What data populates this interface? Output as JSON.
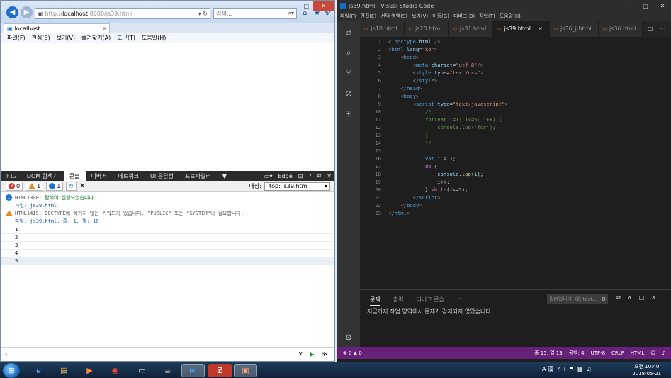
{
  "ie": {
    "url_prefix": "http://",
    "url_host": "localhost",
    "url_rest": ":8080/js39.html",
    "search_placeholder": "검색...",
    "tab_title": "localhost",
    "menu": [
      "파일(F)",
      "편집(E)",
      "보기(V)",
      "즐겨찾기(A)",
      "도구(T)",
      "도움말(H)"
    ],
    "devtools": {
      "f12_label": "F12",
      "tabs": [
        "DOM 탐색기",
        "콘솔",
        "디버거",
        "네트워크",
        "UI 응답성",
        "프로파일러"
      ],
      "active_tab": "콘솔",
      "mode_label": "Edge",
      "error_count": "0",
      "warning_count": "1",
      "info_count": "1",
      "target_label": "대상:",
      "target_value": "_top: js39.html",
      "messages": [
        {
          "code": "HTML1300:",
          "text": "탐색이 실행되었습니다.",
          "file": "파일: js39.html"
        },
        {
          "code": "HTML1419:",
          "text": "DOCTYPE에 예기치 않은 키워드가 있습니다. \"PUBLIC\" 또는 \"SYSTEM\"이 필요합니다.",
          "file": "파일: js39.html, 줄: 1, 열: 16"
        }
      ],
      "outputs": [
        "1",
        "2",
        "3",
        "4",
        "5"
      ],
      "prompt": "›"
    }
  },
  "vscode": {
    "title": "js39.html - Visual Studio Code",
    "menu": [
      "파일(F)",
      "편집(E)",
      "선택 영역(S)",
      "보기(V)",
      "이동(G)",
      "디버그(D)",
      "작업(T)",
      "도움말(H)"
    ],
    "tabs": [
      "js18.html",
      "js20.html",
      "js31.html",
      "js39.html",
      "js36_j.html",
      "js36.html"
    ],
    "active_tab": "js39.html",
    "line_numbers": [
      "1",
      "2",
      "3",
      "4",
      "5",
      "6",
      "7",
      "8",
      "9",
      "10",
      "11",
      "12",
      "13",
      "14",
      "15",
      "16",
      "17",
      "18",
      "19",
      "20",
      "21",
      "22",
      "23"
    ],
    "panel": {
      "tabs": [
        "문제",
        "출력",
        "디버그 콘솔",
        "···"
      ],
      "active_tab": "문제",
      "filter_placeholder": "필터입니다. 예: text...",
      "message": "지금까지 작업 영역에서 문제가 감지되지 않았습니다."
    },
    "status": {
      "errors": "0",
      "warnings": "0",
      "position": "줄 15, 열 13",
      "spaces": "공백: 4",
      "encoding": "UTF-8",
      "eol": "CRLF",
      "language": "HTML"
    }
  },
  "taskbar": {
    "time": "오전 10:40",
    "date": "2018-05-21",
    "ime": "A 漢"
  },
  "colors": {
    "vs_status": "#68217a",
    "ie_accent": "#1f6fc9"
  }
}
